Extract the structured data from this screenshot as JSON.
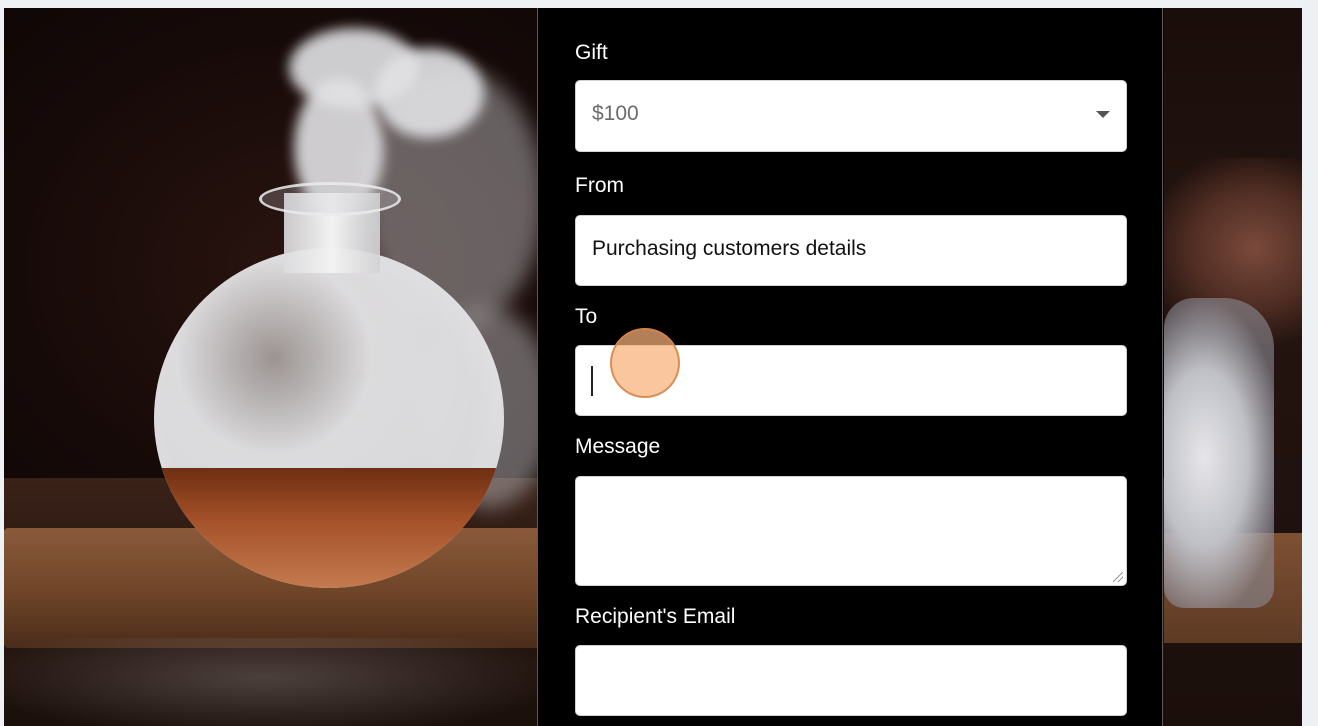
{
  "form": {
    "gift": {
      "label": "Gift",
      "selected_value": "$100"
    },
    "from": {
      "label": "From",
      "value": "Purchasing customers details"
    },
    "to": {
      "label": "To",
      "value": ""
    },
    "message": {
      "label": "Message",
      "value": ""
    },
    "recipient_email": {
      "label": "Recipient's Email",
      "value": ""
    }
  },
  "colors": {
    "panel_background": "#000000",
    "label_text": "#ffffff",
    "field_background": "#ffffff",
    "cursor_highlight": "#f6b078"
  },
  "icons": {
    "select_arrow": "chevron-down-icon",
    "textarea_resize": "resize-grip-icon"
  }
}
